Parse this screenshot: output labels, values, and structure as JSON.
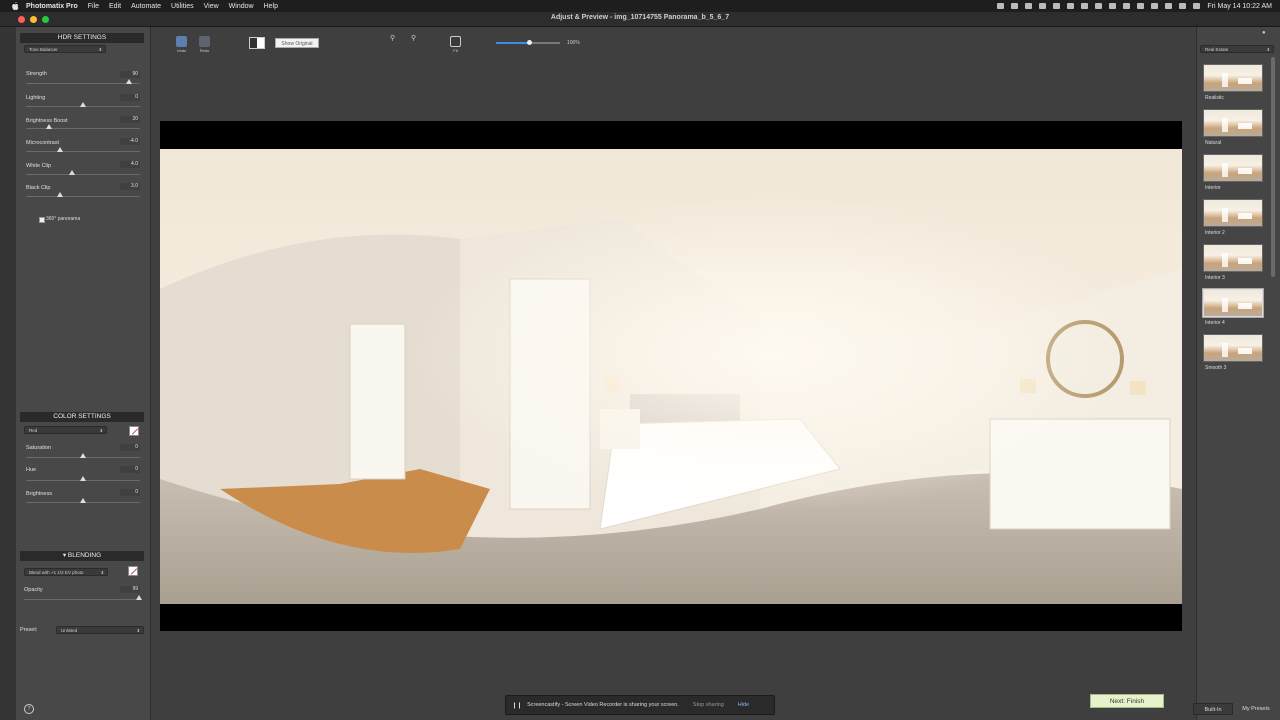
{
  "menubar": {
    "app_name": "Photomatix Pro",
    "menus": [
      "File",
      "Edit",
      "Automate",
      "Utilities",
      "View",
      "Window",
      "Help"
    ],
    "clock": "Fri May 14  10:22 AM"
  },
  "window": {
    "title": "Adjust & Preview - img_10714755 Panorama_b_5_6_7"
  },
  "toolbar": {
    "undo_label": "Undo",
    "redo_label": "Redo",
    "show_original_label": "Show Original",
    "fit_label": "Fit",
    "zoom_percent_label": "100%",
    "zoom_fraction": 0.52
  },
  "hdr_settings": {
    "title": "HDR SETTINGS",
    "method": "Tone Balancer",
    "sliders": [
      {
        "label": "Strength",
        "value": "90",
        "fraction": 0.9
      },
      {
        "label": "Lighting",
        "value": "0",
        "fraction": 0.5
      },
      {
        "label": "Brightness Boost",
        "value": "20",
        "fraction": 0.2
      },
      {
        "label": "Microcontrast",
        "value": "-4.0",
        "fraction": 0.3
      },
      {
        "label": "White Clip",
        "value": "4.0",
        "fraction": 0.4
      },
      {
        "label": "Black Clip",
        "value": "3.0",
        "fraction": 0.3
      }
    ],
    "panorama_checkbox_label": "360° panorama"
  },
  "color_settings": {
    "title": "COLOR SETTINGS",
    "channel": "Red",
    "sliders": [
      {
        "label": "Saturation",
        "value": "0",
        "fraction": 0.5
      },
      {
        "label": "Hue",
        "value": "0",
        "fraction": 0.5
      },
      {
        "label": "Brightness",
        "value": "0",
        "fraction": 0.5
      }
    ]
  },
  "blending": {
    "title": "BLENDING",
    "mode": "Blend with +1 1/2 EV photo",
    "opacity_label": "Opacity",
    "opacity_value": "99",
    "opacity_fraction": 0.99
  },
  "preset": {
    "label": "Preset:",
    "value": "Unlisted"
  },
  "presets_panel": {
    "category": "Real Estate",
    "items": [
      "Realistic",
      "Natural",
      "Interior",
      "Interior 2",
      "Interior 3",
      "Interior 4",
      "Smooth 3"
    ],
    "selected_index": 5
  },
  "footer": {
    "next_button": "Next: Finish",
    "tabs": [
      "Built-In",
      "My Presets"
    ],
    "notification_text": "Screencastify - Screen Video Recorder is sharing your screen.",
    "stop_sharing": "Stop sharing",
    "hide": "Hide"
  },
  "colors": {
    "accent": "#3a8ee6",
    "next_button_bg": "#e6f2c9",
    "traffic_close": "#ff5f57",
    "traffic_min": "#febc2e",
    "traffic_max": "#28c840"
  }
}
